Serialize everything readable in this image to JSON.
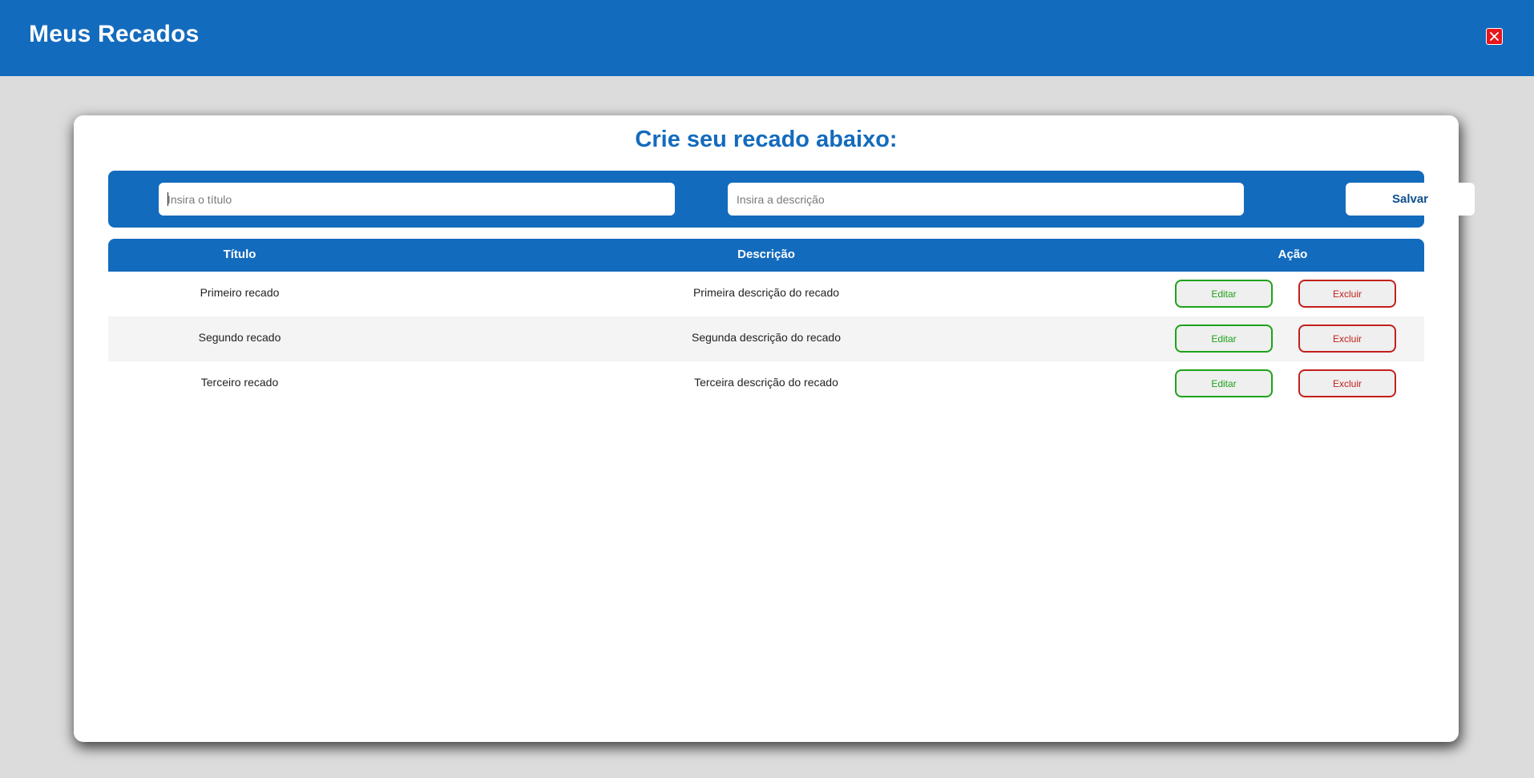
{
  "header": {
    "title": "Meus Recados",
    "close_icon": "close-icon",
    "close_color": "#e8151b"
  },
  "form": {
    "heading": "Crie seu recado abaixo:",
    "title_placeholder": "Insira o título",
    "title_value": "",
    "description_placeholder": "Insira a descrição",
    "description_value": "",
    "save_label": "Salvar"
  },
  "table": {
    "columns": [
      "Título",
      "Descrição",
      "Ação"
    ],
    "rows": [
      {
        "title": "Primeiro recado",
        "description": "Primeira descrição do recado",
        "edit_label": "Editar",
        "delete_label": "Excluir"
      },
      {
        "title": "Segundo recado",
        "description": "Segunda descrição do recado",
        "edit_label": "Editar",
        "delete_label": "Excluir"
      },
      {
        "title": "Terceiro recado",
        "description": "Terceira descrição do recado",
        "edit_label": "Editar",
        "delete_label": "Excluir"
      }
    ]
  },
  "colors": {
    "primary": "#136bbd",
    "edit": "#1ea21a",
    "delete": "#c2201c",
    "background": "#dcdcdc"
  }
}
